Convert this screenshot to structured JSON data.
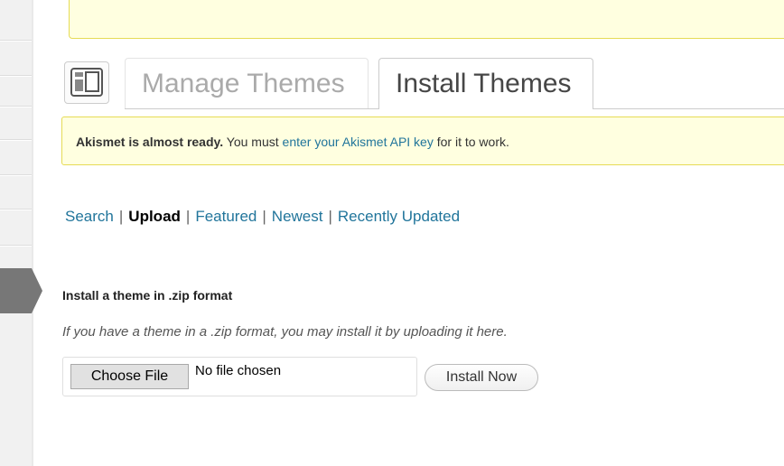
{
  "tabs": {
    "manage_label": "Manage Themes",
    "install_label": "Install Themes"
  },
  "notice": {
    "bold": "Akismet is almost ready.",
    "before_link": " You must ",
    "link": "enter your Akismet API key",
    "after_link": " for it to work."
  },
  "subnav": {
    "search": "Search",
    "upload": "Upload",
    "featured": "Featured",
    "newest": "Newest",
    "recently_updated": "Recently Updated",
    "separator": "|"
  },
  "upload": {
    "title": "Install a theme in .zip format",
    "description": "If you have a theme in a .zip format, you may install it by uploading it here.",
    "choose_file_label": "Choose File",
    "no_file_text": "No file chosen",
    "install_now_label": "Install Now"
  },
  "colors": {
    "link": "#21759b",
    "notice_bg": "#ffffe0",
    "notice_border": "#e6db55"
  }
}
